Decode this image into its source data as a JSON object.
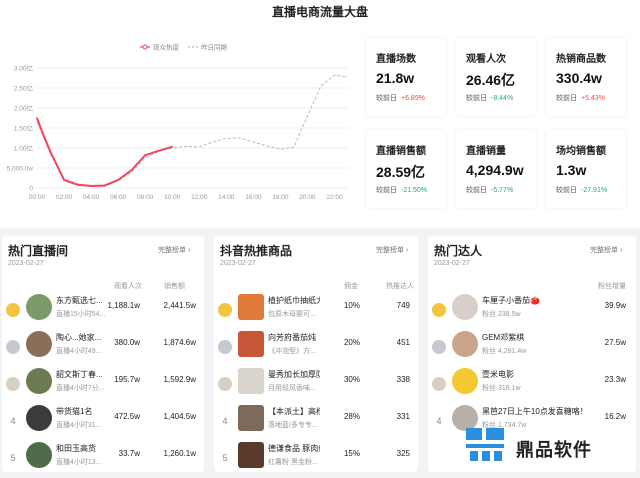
{
  "title": "直播电商流量大盘",
  "chart_data": {
    "type": "line",
    "legend": [
      "观众热度",
      "昨日同期"
    ],
    "x": [
      "00:00",
      "02:00",
      "04:00",
      "06:00",
      "08:00",
      "10:00",
      "12:00",
      "14:00",
      "16:00",
      "18:00",
      "20:00",
      "22:00"
    ],
    "yticks": [
      "0",
      "5,000.0w",
      "1.00亿",
      "1.50亿",
      "2.00亿",
      "2.50亿",
      "3.00亿"
    ],
    "ylim": [
      0,
      30000
    ],
    "series": [
      {
        "name": "观众热度",
        "color": "#f0465a",
        "style": "solid",
        "x": [
          0,
          0.5,
          1,
          1.5,
          2,
          3,
          4,
          5,
          6,
          7,
          8,
          9,
          10
        ],
        "y": [
          17500,
          13000,
          9000,
          5500,
          2000,
          800,
          500,
          600,
          2000,
          4500,
          8200,
          9300,
          10300
        ]
      },
      {
        "name": "昨日同期",
        "color": "#b9b9b9",
        "style": "dashed",
        "x": [
          0,
          0.5,
          1,
          1.5,
          2,
          3,
          4,
          5,
          6,
          7,
          8,
          9,
          10,
          11,
          12,
          13,
          14,
          15,
          16,
          17,
          18,
          19,
          20,
          21,
          22,
          23
        ],
        "y": [
          16500,
          12500,
          8500,
          5500,
          2500,
          1000,
          700,
          700,
          1800,
          4000,
          7500,
          9200,
          10000,
          10400,
          10300,
          11500,
          12400,
          12500,
          11500,
          10500,
          9700,
          10200,
          18000,
          25500,
          28200,
          27800
        ]
      }
    ]
  },
  "stats": [
    {
      "label": "直播场数",
      "value": "21.8w",
      "cmp_label": "较前日",
      "change": "+6.89%",
      "dir": "up"
    },
    {
      "label": "观看人次",
      "value": "26.46亿",
      "cmp_label": "较前日",
      "change": "-8.44%",
      "dir": "down"
    },
    {
      "label": "热销商品数",
      "value": "330.4w",
      "cmp_label": "较前日",
      "change": "+5.43%",
      "dir": "up"
    },
    {
      "label": "直播销售额",
      "value": "28.59亿",
      "cmp_label": "较前日",
      "change": "-21.50%",
      "dir": "down"
    },
    {
      "label": "直播销量",
      "value": "4,294.9w",
      "cmp_label": "较前日",
      "change": "-5.77%",
      "dir": "down"
    },
    {
      "label": "场均销售额",
      "value": "1.3w",
      "cmp_label": "较前日",
      "change": "-27.91%",
      "dir": "down"
    }
  ],
  "hot_live": {
    "title": "热门直播间",
    "more": "完整榜单",
    "date": "2023-02-27",
    "cols": [
      "观看人次",
      "销售额"
    ],
    "rows": [
      {
        "rank": "1",
        "name": "东方甄选七...",
        "sub": "直播15小时54...",
        "v1": "1,188.1w",
        "v2": "2,441.5w",
        "color": "#7a9a6a"
      },
      {
        "rank": "2",
        "name": "陶心...她家...",
        "sub": "直播4小时49...",
        "v1": "380.0w",
        "v2": "1,874.6w",
        "color": "#8a6e5a"
      },
      {
        "rank": "3",
        "name": "韶文斯丁春...",
        "sub": "直播4小时7分...",
        "v1": "195.7w",
        "v2": "1,592.9w",
        "color": "#6d7b53"
      },
      {
        "rank": "4",
        "name": "带货猫1名",
        "sub": "直播4小时31...",
        "v1": "472.5w",
        "v2": "1,404.5w",
        "color": "#3b3b3b"
      },
      {
        "rank": "5",
        "name": "和田玉高货",
        "sub": "直播4小时13...",
        "v1": "33.7w",
        "v2": "1,260.1w",
        "color": "#4e6b4a"
      }
    ]
  },
  "hot_goods": {
    "title": "抖音热推商品",
    "more": "完整榜单",
    "date": "2023-02-27",
    "cols": [
      "佣金",
      "热推达人"
    ],
    "rows": [
      {
        "rank": "1",
        "name": "植护纸巾抽纸大",
        "sub": "包原木母婴可...",
        "v1": "10%",
        "v2": "749",
        "color": "#e07a3a"
      },
      {
        "rank": "2",
        "name": "向芳府番茄炖",
        "sub": "《冲泡型》方...",
        "v1": "20%",
        "v2": "451",
        "color": "#c8573a"
      },
      {
        "rank": "3",
        "name": "曼秀加长加厚防",
        "sub": "月用轻风香味...",
        "v1": "30%",
        "v2": "338",
        "color": "#d9d4cc"
      },
      {
        "rank": "4",
        "name": "【本派土】高档",
        "sub": "落地蓝/多专专...",
        "v1": "28%",
        "v2": "331",
        "color": "#7d6a58"
      },
      {
        "rank": "5",
        "name": "德谦食品 豚肉纯",
        "sub": "红薯粉 黑金粉...",
        "v1": "15%",
        "v2": "325",
        "color": "#5a3a2a"
      }
    ]
  },
  "hot_talent": {
    "title": "热门达人",
    "more": "完整榜单",
    "date": "2023-02-27",
    "cols": [
      "粉丝增量"
    ],
    "rows": [
      {
        "rank": "1",
        "name": "车厘子小番茄🍅",
        "sub": "粉丝 238.5w",
        "v1": "39.9w",
        "color": "#d8cfcb"
      },
      {
        "rank": "2",
        "name": "GEM邓紫棋",
        "sub": "粉丝 4,281.4w",
        "v1": "27.5w",
        "color": "#caa48a"
      },
      {
        "rank": "3",
        "name": "壹米电影",
        "sub": "粉丝 316.1w",
        "v1": "23.3w",
        "color": "#f3c830"
      },
      {
        "rank": "4",
        "name": "黑芭27日上午10点发喜糖咯！",
        "sub": "粉丝 1,734.7w",
        "v1": "16.2w",
        "color": "#b8b0a8"
      }
    ]
  },
  "watermark": "鼎品软件"
}
